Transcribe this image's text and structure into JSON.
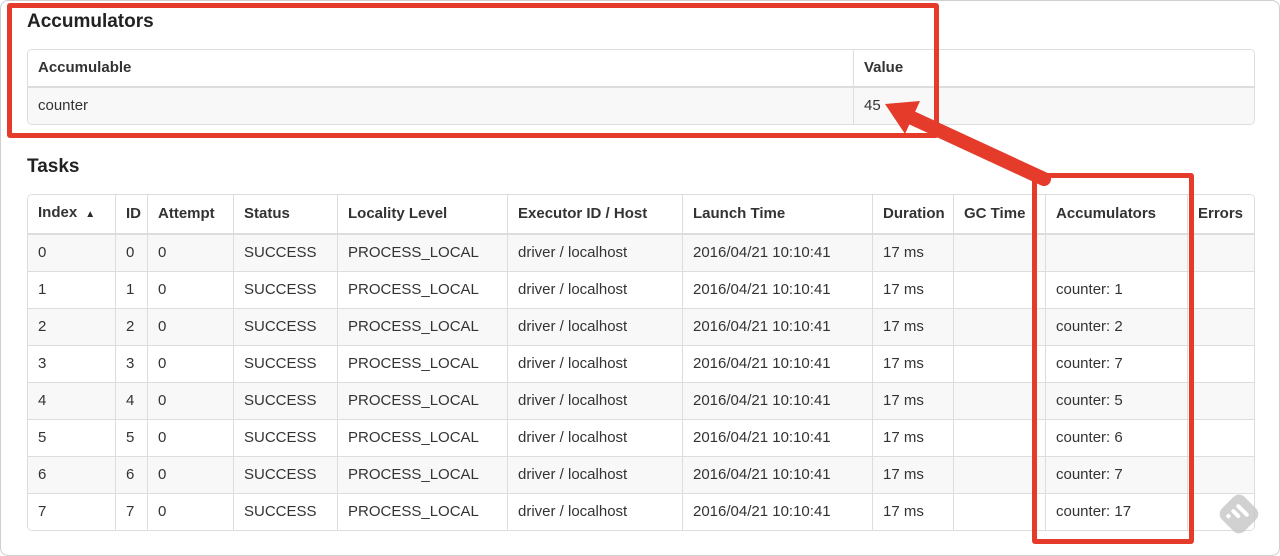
{
  "annotations": {
    "accent_red": "#e53b2b"
  },
  "accumulators_section": {
    "title": "Accumulators",
    "table": {
      "col_accumulable": "Accumulable",
      "col_value": "Value",
      "rows": [
        {
          "accumulable": "counter",
          "value": "45"
        }
      ]
    }
  },
  "tasks_section": {
    "title": "Tasks",
    "table": {
      "headers": [
        "Index",
        "ID",
        "Attempt",
        "Status",
        "Locality Level",
        "Executor ID / Host",
        "Launch Time",
        "Duration",
        "GC Time",
        "Accumulators",
        "Errors"
      ],
      "sort_indicator": "▲",
      "rows": [
        {
          "index": "0",
          "id": "0",
          "attempt": "0",
          "status": "SUCCESS",
          "locality_level": "PROCESS_LOCAL",
          "executor_id_host": "driver / localhost",
          "launch_time": "2016/04/21 10:10:41",
          "duration": "17 ms",
          "gc_time": "",
          "accumulators": "",
          "errors": ""
        },
        {
          "index": "1",
          "id": "1",
          "attempt": "0",
          "status": "SUCCESS",
          "locality_level": "PROCESS_LOCAL",
          "executor_id_host": "driver / localhost",
          "launch_time": "2016/04/21 10:10:41",
          "duration": "17 ms",
          "gc_time": "",
          "accumulators": "counter: 1",
          "errors": ""
        },
        {
          "index": "2",
          "id": "2",
          "attempt": "0",
          "status": "SUCCESS",
          "locality_level": "PROCESS_LOCAL",
          "executor_id_host": "driver / localhost",
          "launch_time": "2016/04/21 10:10:41",
          "duration": "17 ms",
          "gc_time": "",
          "accumulators": "counter: 2",
          "errors": ""
        },
        {
          "index": "3",
          "id": "3",
          "attempt": "0",
          "status": "SUCCESS",
          "locality_level": "PROCESS_LOCAL",
          "executor_id_host": "driver / localhost",
          "launch_time": "2016/04/21 10:10:41",
          "duration": "17 ms",
          "gc_time": "",
          "accumulators": "counter: 7",
          "errors": ""
        },
        {
          "index": "4",
          "id": "4",
          "attempt": "0",
          "status": "SUCCESS",
          "locality_level": "PROCESS_LOCAL",
          "executor_id_host": "driver / localhost",
          "launch_time": "2016/04/21 10:10:41",
          "duration": "17 ms",
          "gc_time": "",
          "accumulators": "counter: 5",
          "errors": ""
        },
        {
          "index": "5",
          "id": "5",
          "attempt": "0",
          "status": "SUCCESS",
          "locality_level": "PROCESS_LOCAL",
          "executor_id_host": "driver / localhost",
          "launch_time": "2016/04/21 10:10:41",
          "duration": "17 ms",
          "gc_time": "",
          "accumulators": "counter: 6",
          "errors": ""
        },
        {
          "index": "6",
          "id": "6",
          "attempt": "0",
          "status": "SUCCESS",
          "locality_level": "PROCESS_LOCAL",
          "executor_id_host": "driver / localhost",
          "launch_time": "2016/04/21 10:10:41",
          "duration": "17 ms",
          "gc_time": "",
          "accumulators": "counter: 7",
          "errors": ""
        },
        {
          "index": "7",
          "id": "7",
          "attempt": "0",
          "status": "SUCCESS",
          "locality_level": "PROCESS_LOCAL",
          "executor_id_host": "driver / localhost",
          "launch_time": "2016/04/21 10:10:41",
          "duration": "17 ms",
          "gc_time": "",
          "accumulators": "counter: 17",
          "errors": ""
        }
      ]
    }
  },
  "watermark_icon": "skitch-feedly-style-watermark"
}
